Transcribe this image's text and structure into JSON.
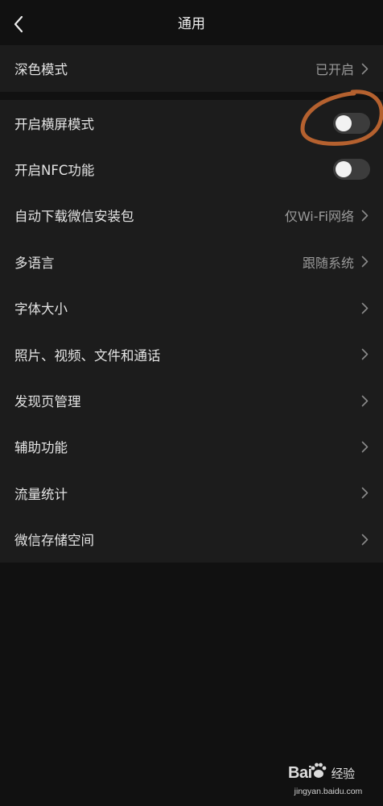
{
  "header": {
    "title": "通用",
    "back_icon": "chevron-left-icon"
  },
  "dark_mode": {
    "label": "深色模式",
    "value": "已开启"
  },
  "settings": [
    {
      "label": "开启横屏模式",
      "control": "toggle",
      "on": false
    },
    {
      "label": "开启NFC功能",
      "control": "toggle",
      "on": false
    },
    {
      "label": "自动下载微信安装包",
      "value": "仅Wi-Fi网络",
      "control": "chevron"
    },
    {
      "label": "多语言",
      "value": "跟随系统",
      "control": "chevron"
    },
    {
      "label": "字体大小",
      "control": "chevron"
    },
    {
      "label": "照片、视频、文件和通话",
      "control": "chevron"
    },
    {
      "label": "发现页管理",
      "control": "chevron"
    },
    {
      "label": "辅助功能",
      "control": "chevron"
    },
    {
      "label": "流量统计",
      "control": "chevron"
    },
    {
      "label": "微信存储空间",
      "control": "chevron"
    }
  ],
  "watermark": {
    "brand": "Bai",
    "brand_suffix": "经验",
    "url": "jingyan.baidu.com"
  },
  "colors": {
    "background": "#111111",
    "row_background": "#1c1c1c",
    "annotation": "#b5612f",
    "toggle_off": "#3c3c3c"
  }
}
